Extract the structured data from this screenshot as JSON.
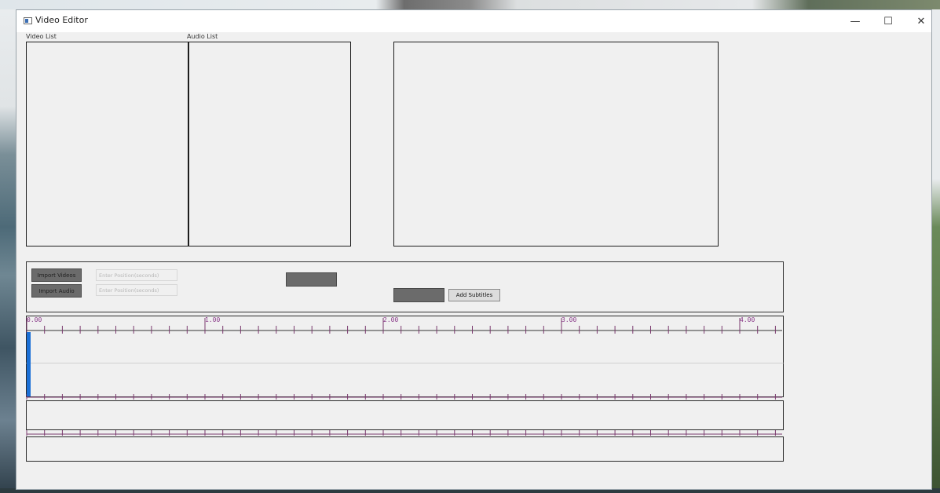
{
  "window": {
    "title": "Video Editor",
    "controls": {
      "minimize": "—",
      "maximize": "☐",
      "close": "✕"
    }
  },
  "lists": {
    "video_label": "Video List",
    "audio_label": "Audio List"
  },
  "controls": {
    "import_videos": "Import Videos",
    "import_audio": "Import Audio",
    "video_position_placeholder": "Enter Position(seconds)",
    "audio_position_placeholder": "Enter Position(seconds)",
    "add_subtitles": "Add Subtitles"
  },
  "timeline": {
    "labels": [
      "0.00",
      "1.00",
      "2.00",
      "3.00",
      "4.00"
    ],
    "playhead_seconds": 0
  },
  "colors": {
    "tick": "#7a3a6e",
    "playhead": "#1a6fd6"
  }
}
